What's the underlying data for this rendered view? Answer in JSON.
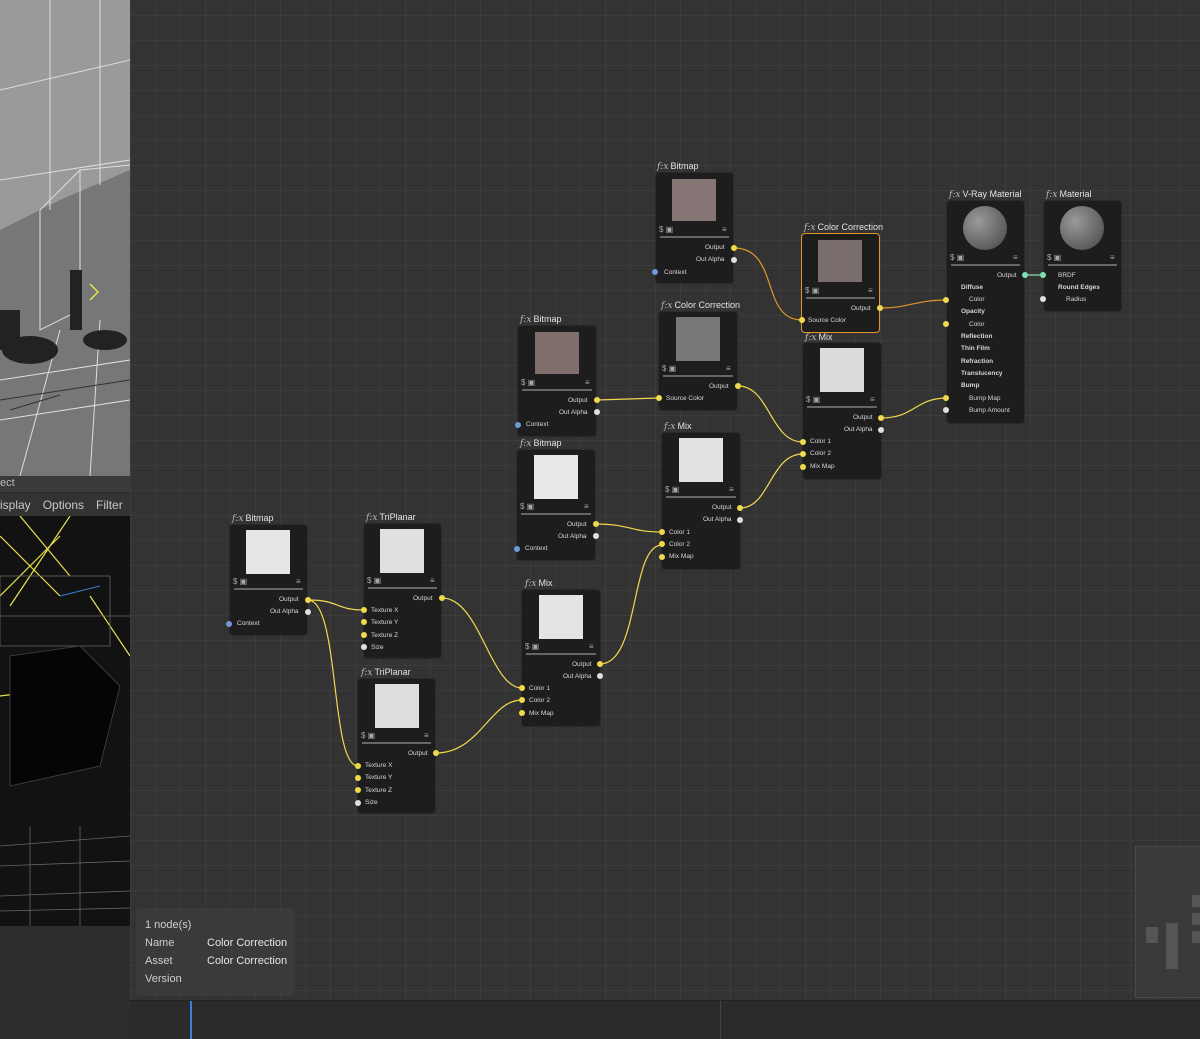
{
  "viewport": {
    "status_text": "ect",
    "menu": [
      "isplay",
      "Options",
      "Filter"
    ]
  },
  "fx_prefix": "f:x",
  "nodes": {
    "bitmap_top": {
      "title": "Bitmap",
      "outputs": [
        "Output",
        "Out Alpha"
      ],
      "inputs": [
        "Context"
      ]
    },
    "cc_selected": {
      "title": "Color Correction",
      "outputs": [
        "Output"
      ],
      "inputs": [
        "Source Color"
      ]
    },
    "vray": {
      "title": "V-Ray Material",
      "outputs": [
        "Output"
      ],
      "inputs": [
        "Diffuse",
        "Color",
        "Opacity",
        "Color",
        "Reflection",
        "Thin Film",
        "Refraction",
        "Translucency",
        "Bump",
        "Bump Map",
        "Bump Amount"
      ]
    },
    "material": {
      "title": "Material",
      "inputs": [
        "BRDF",
        "Round Edges",
        "Radius"
      ]
    },
    "bitmap_mid": {
      "title": "Bitmap",
      "outputs": [
        "Output",
        "Out Alpha"
      ],
      "inputs": [
        "Context"
      ]
    },
    "cc2": {
      "title": "Color Correction",
      "outputs": [
        "Output"
      ],
      "inputs": [
        "Source Color"
      ]
    },
    "mix_right": {
      "title": "Mix",
      "outputs": [
        "Output",
        "Out Alpha"
      ],
      "inputs": [
        "Color 1",
        "Color 2",
        "Mix Map"
      ]
    },
    "bitmap_mid2": {
      "title": "Bitmap",
      "outputs": [
        "Output",
        "Out Alpha"
      ],
      "inputs": [
        "Context"
      ]
    },
    "mix_mid": {
      "title": "Mix",
      "outputs": [
        "Output",
        "Out Alpha"
      ],
      "inputs": [
        "Color 1",
        "Color 2",
        "Mix Map"
      ]
    },
    "bitmap_left": {
      "title": "Bitmap",
      "outputs": [
        "Output",
        "Out Alpha"
      ],
      "inputs": [
        "Context"
      ]
    },
    "triplanar1": {
      "title": "TriPlanar",
      "outputs": [
        "Output"
      ],
      "inputs": [
        "Texture X",
        "Texture Y",
        "Texture Z",
        "Size"
      ]
    },
    "mix_low": {
      "title": "Mix",
      "outputs": [
        "Output",
        "Out Alpha"
      ],
      "inputs": [
        "Color 1",
        "Color 2",
        "Mix Map"
      ]
    },
    "triplanar2": {
      "title": "TriPlanar",
      "outputs": [
        "Output"
      ],
      "inputs": [
        "Texture X",
        "Texture Y",
        "Texture Z",
        "Size"
      ]
    }
  },
  "info_panel": {
    "count": "1 node(s)",
    "name_label": "Name",
    "name_value": "Color Correction",
    "asset_label": "Asset",
    "asset_value": "Color Correction",
    "version_label": "Version"
  },
  "colors": {
    "wire": "#f1d94e",
    "wire_selected": "#e0962a",
    "wire_green": "#7fe0b0",
    "selection": "#e0962a"
  }
}
